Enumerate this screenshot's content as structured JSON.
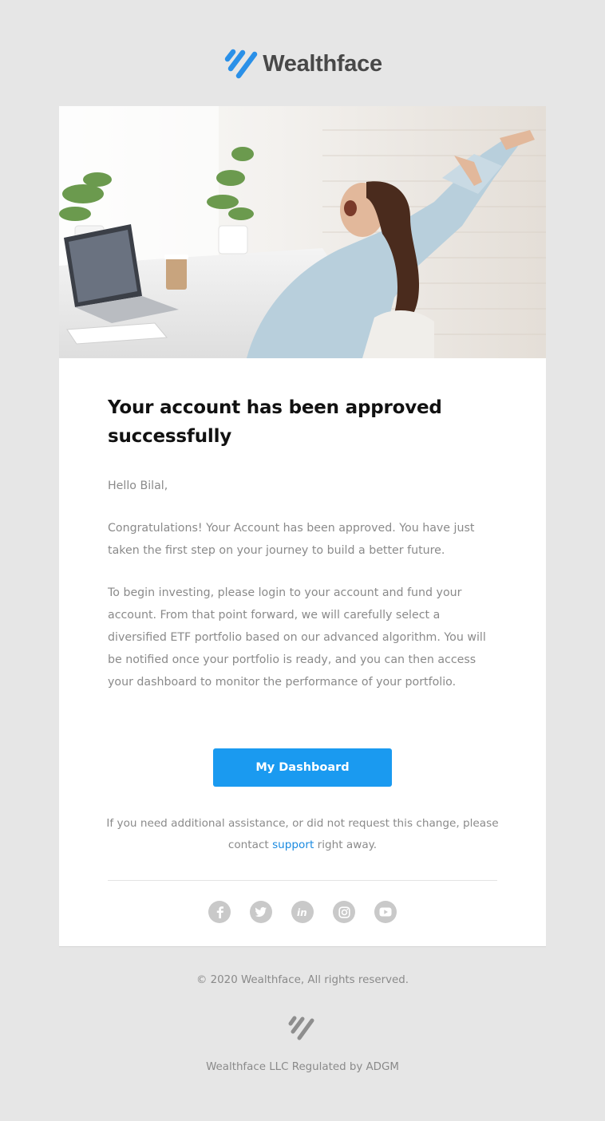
{
  "brand": {
    "name": "Wealthface",
    "accent_color": "#1a9af0",
    "logo_icon": "wealthface-stripes-icon"
  },
  "hero": {
    "image": "woman-stretching-at-desk-photo"
  },
  "email": {
    "headline": "Your account has been approved successfully",
    "greeting": "Hello Bilal,",
    "paragraph_1": "Congratulations! Your Account has been approved. You have just taken the first step on your journey to build a better future.",
    "paragraph_2": "To begin investing, please login to your account and fund your account. From that point forward, we will carefully select a diversified ETF portfolio based on our advanced algorithm. You will be notified once your portfolio is ready, and you can then access your dashboard to monitor the performance of your portfolio.",
    "cta_label": "My Dashboard",
    "assist_before": "If you need additional assistance, or did not request this change, please contact ",
    "assist_link": "support",
    "assist_after": " right away."
  },
  "socials": [
    {
      "name": "facebook-icon"
    },
    {
      "name": "twitter-icon"
    },
    {
      "name": "linkedin-icon"
    },
    {
      "name": "instagram-icon"
    },
    {
      "name": "youtube-icon"
    }
  ],
  "footer": {
    "copyright": "© 2020 Wealthface, All rights reserved.",
    "regulation": "Wealthface LLC Regulated by ADGM"
  }
}
